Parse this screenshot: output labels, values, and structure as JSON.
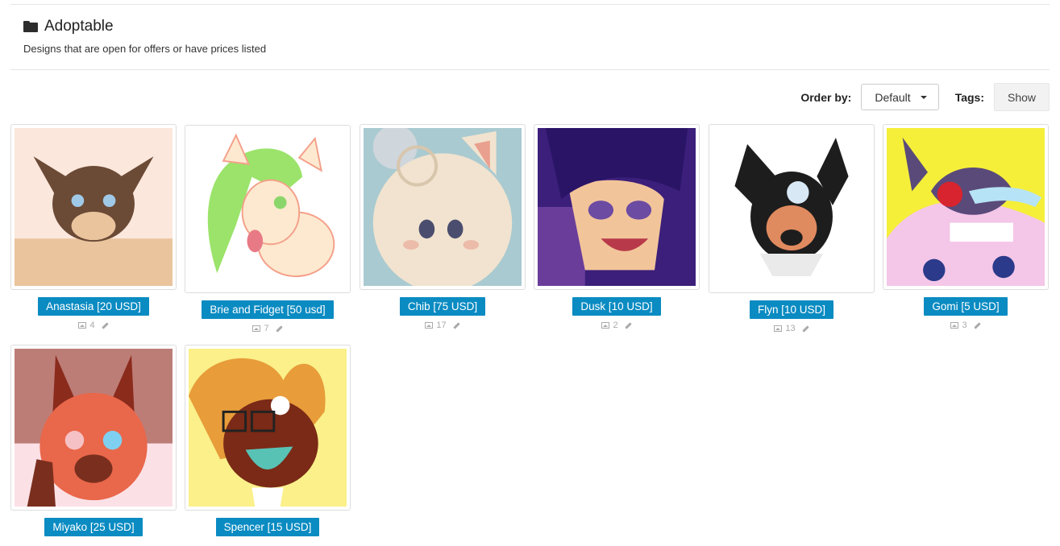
{
  "header": {
    "title": "Adoptable",
    "subtitle": "Designs that are open for offers or have prices listed"
  },
  "controls": {
    "order_label": "Order by:",
    "order_value": "Default",
    "tags_label": "Tags:",
    "tags_button": "Show"
  },
  "designs": [
    {
      "name": "Anastasia [20 USD]",
      "image_count": "4",
      "colors": [
        "#fbe7dc",
        "#6b4a36",
        "#e9c49d"
      ]
    },
    {
      "name": "Brie and Fidget [50 usd]",
      "image_count": "7",
      "colors": [
        "#ffffff",
        "#9be36a",
        "#fde9cf"
      ]
    },
    {
      "name": "Chib [75 USD]",
      "image_count": "17",
      "colors": [
        "#a9cad0",
        "#f1e3cf",
        "#e9a08f"
      ]
    },
    {
      "name": "Dusk [10 USD]",
      "image_count": "2",
      "colors": [
        "#3b1f7a",
        "#6a3d9a",
        "#f2c49a"
      ]
    },
    {
      "name": "Flyn [10 USD]",
      "image_count": "13",
      "colors": [
        "#ffffff",
        "#1d1d1d",
        "#e08a5f"
      ]
    },
    {
      "name": "Gomi [5 USD]",
      "image_count": "3",
      "colors": [
        "#f5ef3a",
        "#5a4a7a",
        "#f4c6e8"
      ]
    },
    {
      "name": "Miyako [25 USD]",
      "image_count": "",
      "colors": [
        "#fbe1e6",
        "#8a2b1c",
        "#e9674a"
      ]
    },
    {
      "name": "Spencer [15 USD]",
      "image_count": "",
      "colors": [
        "#fbf08a",
        "#7a2a16",
        "#e89c3a"
      ]
    }
  ]
}
